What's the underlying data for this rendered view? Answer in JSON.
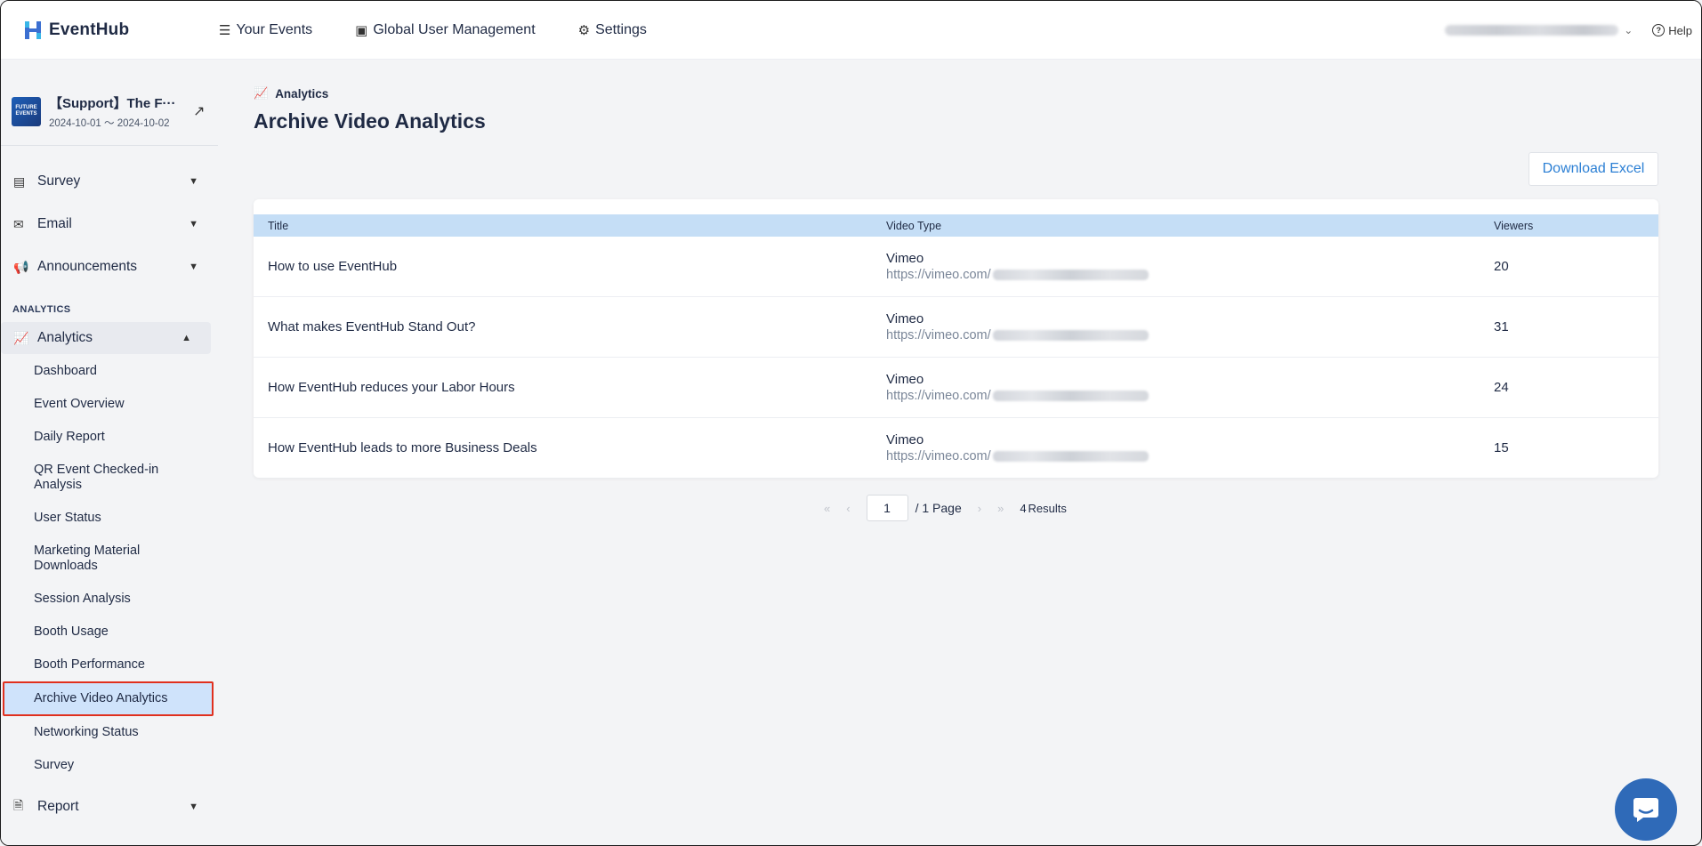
{
  "app": {
    "name": "EventHub"
  },
  "topnav": {
    "items": [
      {
        "label": "Your Events",
        "icon": "list-icon"
      },
      {
        "label": "Global User Management",
        "icon": "id-card-icon"
      },
      {
        "label": "Settings",
        "icon": "gear-icon"
      }
    ],
    "help_label": "Help"
  },
  "event": {
    "name": "【Support】The F···",
    "dates": "2024-10-01 ～ 2024-10-02",
    "thumb_text": "FUTURE EVENTS"
  },
  "sidebar": {
    "groups": [
      {
        "label": "Survey",
        "icon": "clipboard-icon"
      },
      {
        "label": "Email",
        "icon": "mail-icon"
      },
      {
        "label": "Announcements",
        "icon": "megaphone-icon"
      }
    ],
    "section_label": "ANALYTICS",
    "analytics_label": "Analytics",
    "analytics_items": [
      "Dashboard",
      "Event Overview",
      "Daily Report",
      "QR Event Checked-in Analysis",
      "User Status",
      "Marketing Material Downloads",
      "Session Analysis",
      "Booth Usage",
      "Booth Performance",
      "Archive Video Analytics",
      "Networking Status",
      "Survey"
    ],
    "report_label": "Report"
  },
  "main": {
    "breadcrumb": "Analytics",
    "title": "Archive Video Analytics",
    "download_label": "Download Excel",
    "table": {
      "headers": [
        "Title",
        "Video Type",
        "Viewers"
      ],
      "rows": [
        {
          "title": "How to use EventHub",
          "type": "Vimeo",
          "url": "https://vimeo.com/",
          "viewers": "20"
        },
        {
          "title": "What makes EventHub Stand Out?",
          "type": "Vimeo",
          "url": "https://vimeo.com/",
          "viewers": "31"
        },
        {
          "title": "How EventHub reduces your Labor Hours",
          "type": "Vimeo",
          "url": "https://vimeo.com/",
          "viewers": "24"
        },
        {
          "title": "How EventHub leads to more Business Deals",
          "type": "Vimeo",
          "url": "https://vimeo.com/",
          "viewers": "15"
        }
      ]
    },
    "pagination": {
      "current_page": "1",
      "total_pages_text": "/ 1 Page",
      "results_count": "4",
      "results_label": "Results"
    }
  },
  "colors": {
    "accent": "#2b7fd4",
    "table_header": "#c5def6",
    "selected_item": "#cfe3fb",
    "highlight_border": "#e0301e",
    "chat_button": "#2f6ab8"
  }
}
